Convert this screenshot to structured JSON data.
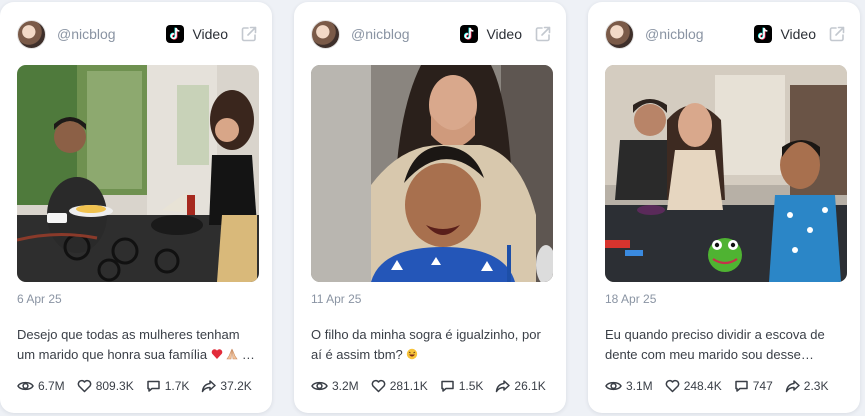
{
  "cards": [
    {
      "author": "@nicblog",
      "type_label": "Video",
      "date": "6 Apr 25",
      "caption_line1": "Desejo que todas as mulheres tenham",
      "caption_line2": "um marido que honra sua família",
      "caption_line2_tail": "…",
      "views": "6.7M",
      "likes": "809.3K",
      "comments": "1.7K",
      "shares": "37.2K"
    },
    {
      "author": "@nicblog",
      "type_label": "Video",
      "date": "11 Apr 25",
      "caption_line1": "O filho da minha sogra é igualzinho, por",
      "caption_line2": "aí é assim tbm?",
      "caption_line2_tail": "",
      "views": "3.2M",
      "likes": "281.1K",
      "comments": "1.5K",
      "shares": "26.1K"
    },
    {
      "author": "@nicblog",
      "type_label": "Video",
      "date": "18 Apr 25",
      "caption_line1": "Eu quando preciso dividir a escova de",
      "caption_line2": "dente com meu marido sou desse…",
      "caption_line2_tail": "",
      "views": "3.1M",
      "likes": "248.4K",
      "comments": "747",
      "shares": "2.3K"
    }
  ],
  "colors": {
    "muted": "#8a94a3",
    "text": "#3a3f47",
    "background": "#eef1f6"
  },
  "icons": [
    "avatar",
    "tiktok-icon",
    "external-link-icon",
    "eye-icon",
    "heart-icon",
    "comment-icon",
    "share-icon"
  ]
}
